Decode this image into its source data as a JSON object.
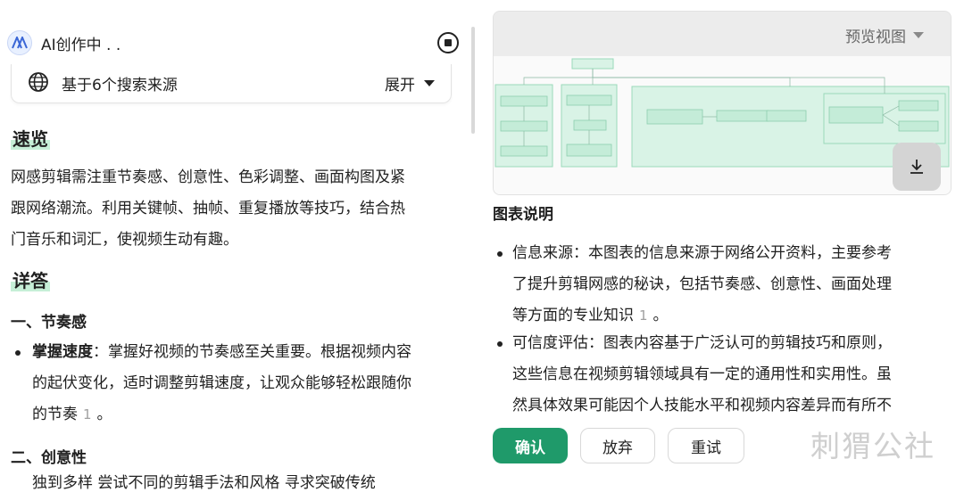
{
  "app": {
    "title": "AI创作中 . .",
    "sources_label": "基于6个搜索来源",
    "sources_toggle": "展开"
  },
  "summary": {
    "heading": "速览",
    "lines": [
      "网感剪辑需注重节奏感、创意性、色彩调整、画面构图及紧",
      "跟网络潮流。利用关键帧、抽帧、重复播放等技巧，结合热",
      "门音乐和词汇，使视频生动有趣。"
    ]
  },
  "details": {
    "heading": "详答",
    "section1_title": "一、节奏感",
    "bullet1": {
      "term": "掌握速度",
      "lines": [
        "：掌握好视频的节奏感至关重要。根据视频内容",
        "的起伏变化，适时调整剪辑速度，让观众能够轻松跟随你",
        "的节奏"
      ],
      "ref": "1",
      "end": "。"
    },
    "section2_title": "二、创意性",
    "cut_off_text": "独到多样  尝试不同的剪辑手法和风格  寻求突破传统"
  },
  "preview": {
    "view_label": "预览视图"
  },
  "explanation": {
    "title": "图表说明",
    "items": [
      {
        "lines": [
          "信息来源：本图表的信息来源于网络公开资料，主要参考",
          "了提升剪辑网感的秘诀，包括节奏感、创意性、画面处理",
          "等方面的专业知识"
        ],
        "ref": "1",
        "end": "。"
      },
      {
        "lines": [
          "可信度评估：图表内容基于广泛认可的剪辑技巧和原则，",
          "这些信息在视频剪辑领域具有一定的通用性和实用性。虽",
          "然具体效果可能因个人技能水平和视频内容差异而有所不"
        ]
      }
    ]
  },
  "actions": {
    "confirm": "确认",
    "discard": "放弃",
    "retry": "重试"
  },
  "watermark": "刺猬公社",
  "colors": {
    "accent": "#1f9a6a",
    "highlight": "#c6efd7",
    "diagram_fill": "#d9f3e6",
    "diagram_stroke": "#9bd9bb"
  },
  "icons": {
    "logo": "ai-logo-icon",
    "stop": "stop-icon",
    "globe": "globe-icon",
    "expand_caret": "chevron-down-icon",
    "download": "download-icon"
  }
}
